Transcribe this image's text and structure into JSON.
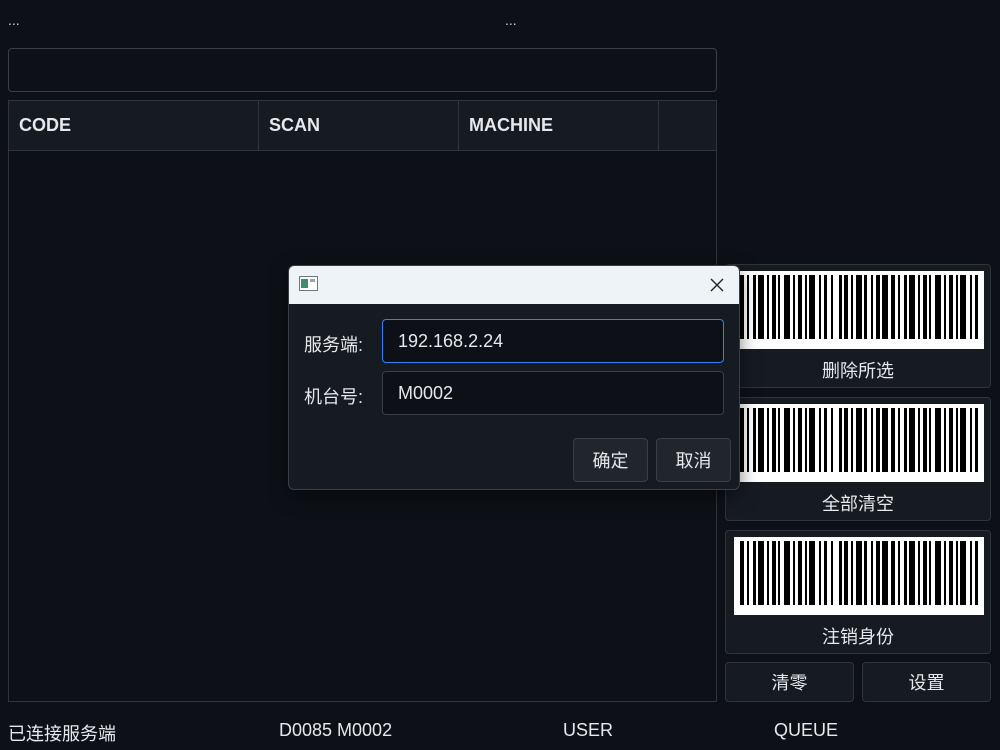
{
  "top": {
    "left_text": "...",
    "mid_text": "..."
  },
  "search": {
    "value": ""
  },
  "table": {
    "columns": [
      "CODE",
      "SCAN",
      "MACHINE",
      ""
    ]
  },
  "actions": {
    "delete_selected": "删除所选",
    "clear_all": "全部清空",
    "logout": "注销身份",
    "zero": "清零",
    "settings": "设置"
  },
  "status": {
    "connection": "已连接服务端",
    "ids": "D0085 M0002",
    "user": "USER",
    "queue": "QUEUE"
  },
  "dialog": {
    "server_label": "服务端:",
    "server_value": "192.168.2.24",
    "machine_label": "机台号:",
    "machine_value": "M0002",
    "ok_label": "确定",
    "cancel_label": "取消"
  },
  "colors": {
    "background": "#0d1117",
    "panel": "#161b22",
    "focus_border": "#2f81f7",
    "dialog_titlebar": "#eef3f7"
  },
  "icons": [
    "window-icon",
    "close-icon",
    "barcode-icon"
  ]
}
